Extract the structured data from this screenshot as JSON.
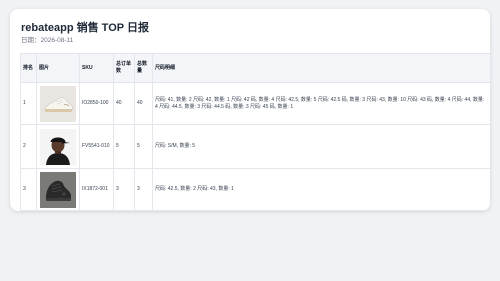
{
  "report": {
    "title": "rebateapp 销售 TOP 日报",
    "date_label": "日期：2026-08-11"
  },
  "table": {
    "headers": {
      "rank": "排名",
      "image": "图片",
      "sku": "SKU",
      "total_orders": "总订单数",
      "total_qty": "总数量",
      "size_detail": "尺码明细"
    },
    "rows": [
      {
        "rank": "1",
        "image_icon": "white-sneaker-product-image",
        "sku": "IO2850-100",
        "total_orders": "40",
        "total_qty": "40",
        "size_detail": "尺码: 41, 数量: 2 尺码: 42, 数量: 1 尺码: 42 码, 数量: 4 尺码: 42.5, 数量: 5 尺码: 42.5 码, 数量: 3 尺码: 43, 数量: 10 尺码: 43 码, 数量: 4 尺码: 44, 数量: 4 尺码: 44.5, 数量: 3 尺码: 44.5 码, 数量: 3 尺码: 45 码, 数量: 1"
      },
      {
        "rank": "2",
        "image_icon": "black-cap-model-product-image",
        "sku": "FV5541-010",
        "total_orders": "5",
        "total_qty": "5",
        "size_detail": "尺码: S/M, 数量: 5"
      },
      {
        "rank": "3",
        "image_icon": "black-basketball-shoe-product-image",
        "sku": "IX1872-001",
        "total_orders": "3",
        "total_qty": "3",
        "size_detail": "尺码: 42.5, 数量: 2 尺码: 43, 数量: 1"
      }
    ]
  }
}
